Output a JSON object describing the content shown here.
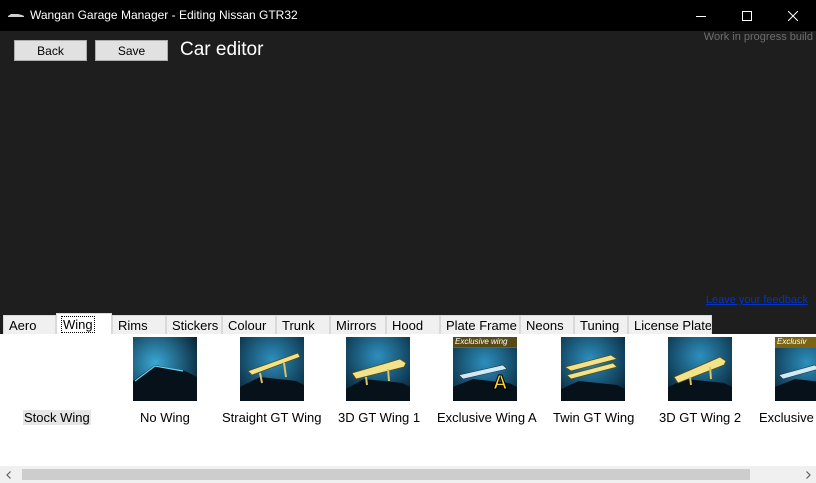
{
  "window": {
    "title": "Wangan Garage Manager - Editing Nissan GTR32",
    "minimize_icon": "minimize-icon",
    "maximize_icon": "maximize-icon",
    "close_icon": "close-icon"
  },
  "toolbar": {
    "back_label": "Back",
    "save_label": "Save",
    "heading": "Car editor",
    "build_notice": "Work in progress build",
    "feedback_link": "Leave your feedback"
  },
  "tabs": [
    {
      "label": "Aero",
      "active": false
    },
    {
      "label": "Wing",
      "active": true
    },
    {
      "label": "Rims",
      "active": false
    },
    {
      "label": "Stickers",
      "active": false
    },
    {
      "label": "Colour",
      "active": false
    },
    {
      "label": "Trunk",
      "active": false
    },
    {
      "label": "Mirrors",
      "active": false
    },
    {
      "label": "Hood",
      "active": false
    },
    {
      "label": "Plate Frame",
      "active": false
    },
    {
      "label": "Neons",
      "active": false
    },
    {
      "label": "Tuning",
      "active": false
    },
    {
      "label": "License Plate",
      "active": false
    }
  ],
  "wing_options": [
    {
      "label": "Stock Wing",
      "selected": true,
      "thumb": "none"
    },
    {
      "label": "No Wing",
      "selected": false,
      "thumb": "no-wing"
    },
    {
      "label": "Straight GT Wing",
      "selected": false,
      "thumb": "gt-wing"
    },
    {
      "label": "3D GT Wing 1",
      "selected": false,
      "thumb": "3d-wing"
    },
    {
      "label": "Exclusive Wing A",
      "selected": false,
      "thumb": "exclusive",
      "badge": "Exclusive wing",
      "letter": "A"
    },
    {
      "label": "Twin GT Wing",
      "selected": false,
      "thumb": "twin-wing"
    },
    {
      "label": "3D GT Wing 2",
      "selected": false,
      "thumb": "3d-wing-2"
    },
    {
      "label": "Exclusive",
      "selected": false,
      "thumb": "exclusive-partial",
      "badge": "Exclusiv"
    }
  ],
  "colors": {
    "titlebar": "#000000",
    "background": "#1e1e1e",
    "link": "#0033cc",
    "wing_highlight": "#f2e28a"
  }
}
